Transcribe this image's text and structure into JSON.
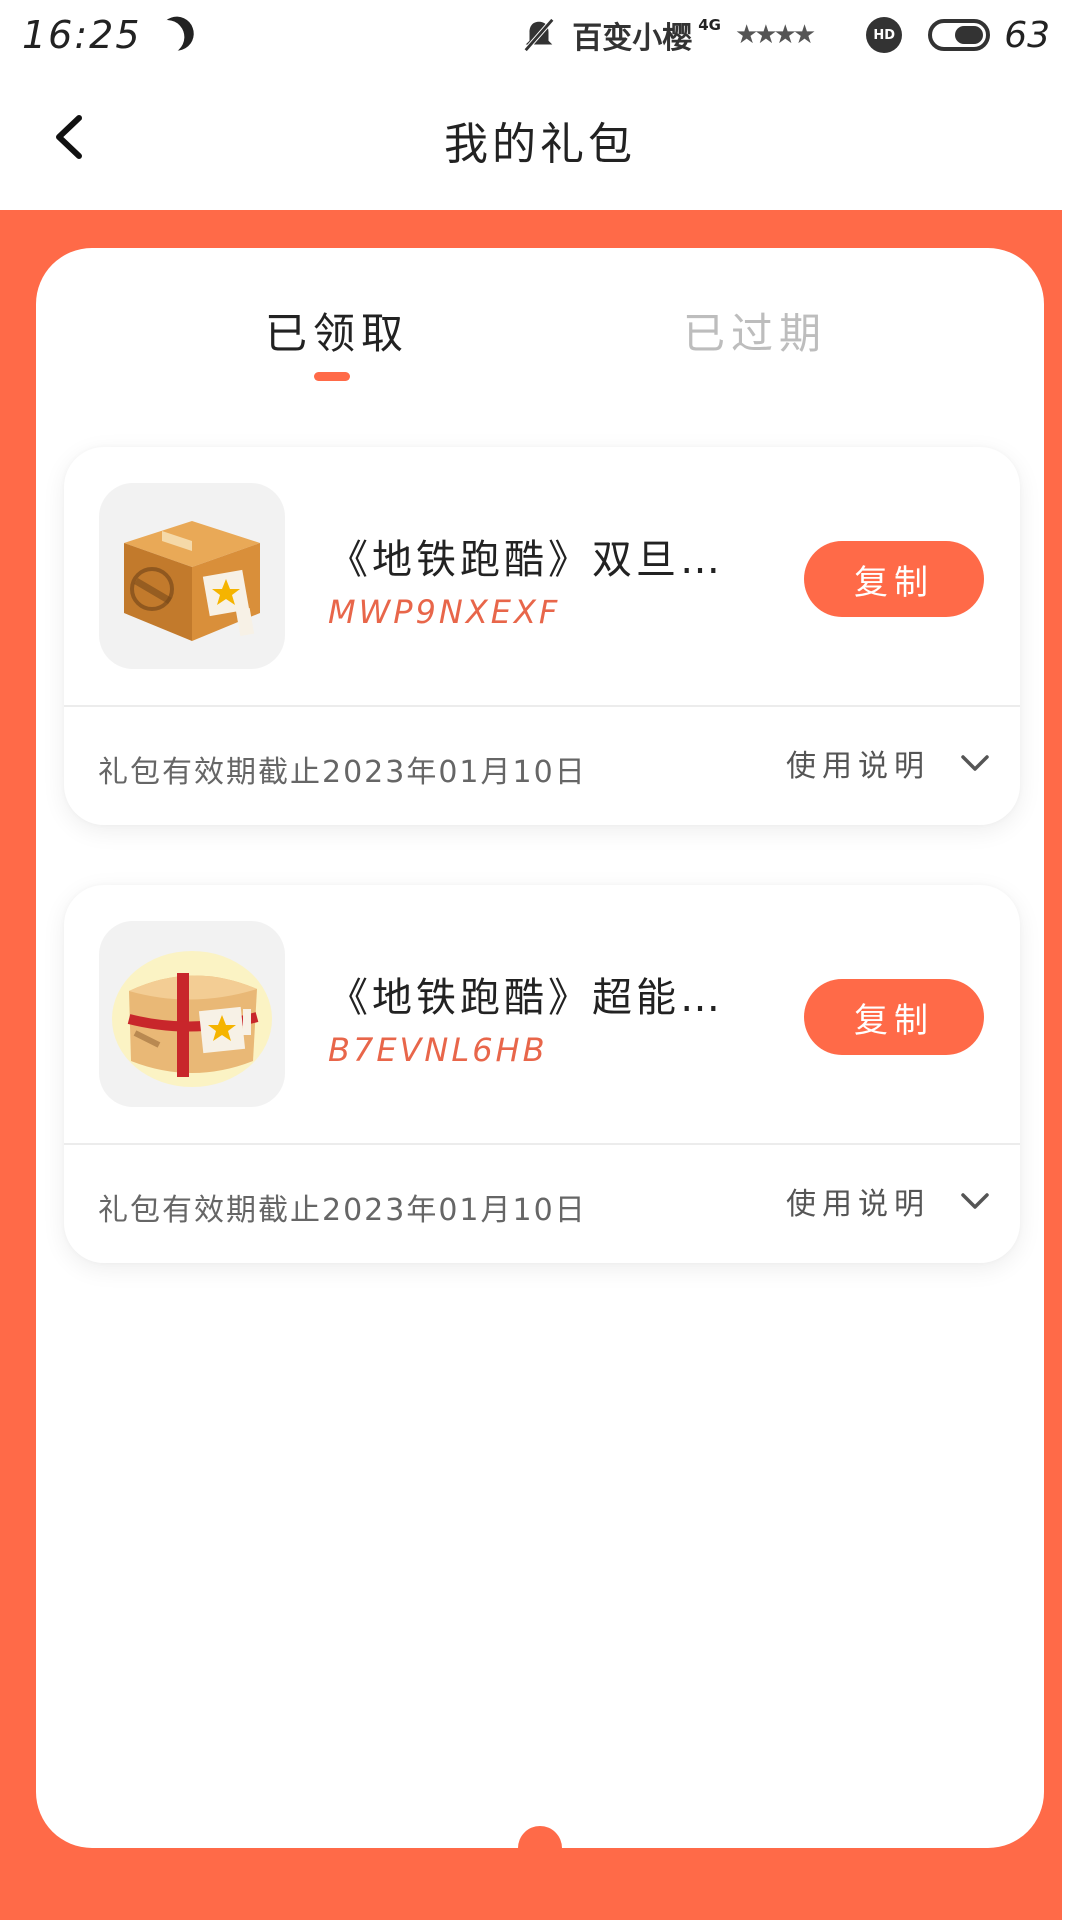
{
  "status_bar": {
    "time": "16:25",
    "carrier": "百变小樱",
    "network": "4G",
    "hd_label": "HD",
    "battery": "63"
  },
  "header": {
    "title": "我的礼包"
  },
  "tabs": [
    {
      "label": "已领取",
      "active": true
    },
    {
      "label": "已过期",
      "active": false
    }
  ],
  "gifts": [
    {
      "name": "《地铁跑酷》双旦…",
      "code": "MWP9NXEXF",
      "copy_label": "复制",
      "expiry": "礼包有效期截止2023年01月10日",
      "usage_label": "使用说明",
      "icon": "package-box-icon"
    },
    {
      "name": "《地铁跑酷》超能…",
      "code": "B7EVNL6HB",
      "copy_label": "复制",
      "expiry": "礼包有效期截止2023年01月10日",
      "usage_label": "使用说明",
      "icon": "gift-parcel-icon"
    }
  ],
  "colors": {
    "accent": "#ff6a48",
    "code": "#e8664a",
    "muted_tab": "#bdbdbd"
  }
}
